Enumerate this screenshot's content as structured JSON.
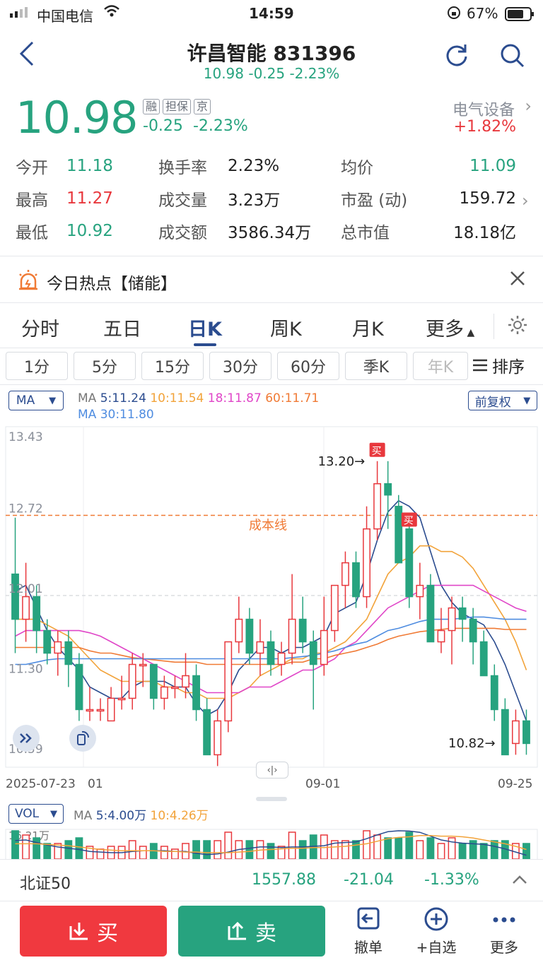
{
  "status_bar": {
    "carrier": "中国电信",
    "time": "14:59",
    "battery": "67%"
  },
  "header": {
    "title": "许昌智能 831396",
    "subtitle": "10.98 -0.25 -2.23%",
    "back_icon": "chevron-left-icon",
    "refresh_icon": "refresh-icon",
    "search_icon": "search-icon"
  },
  "quote": {
    "price": "10.98",
    "tags": [
      "融",
      "担保",
      "京"
    ],
    "change": "-0.25",
    "change_pct": "-2.23%",
    "sector": "电气设备",
    "sector_change": "+1.82%",
    "rows": [
      {
        "l1": "今开",
        "v1": "11.18",
        "l2": "换手率",
        "v2": "2.23%",
        "l3": "均价",
        "v3": "11.09"
      },
      {
        "l1": "最高",
        "v1": "11.27",
        "l2": "成交量",
        "v2": "3.23万",
        "l3": "市盈 (动)",
        "v3": "159.72"
      },
      {
        "l1": "最低",
        "v1": "10.92",
        "l2": "成交额",
        "v2": "3586.34万",
        "l3": "总市值",
        "v3": "18.18亿"
      }
    ]
  },
  "hot": {
    "text": "今日热点【储能】"
  },
  "tabs": [
    "分时",
    "五日",
    "日K",
    "周K",
    "月K",
    "更多"
  ],
  "active_tab": "日K",
  "periods": [
    "1分",
    "5分",
    "15分",
    "30分",
    "60分",
    "季K",
    "年K"
  ],
  "sort_label": "排序",
  "ma": {
    "selector": "MA",
    "line1_prefix": "MA",
    "ma5": "5:11.24",
    "ma10": "10:11.54",
    "ma18": "18:11.87",
    "ma60": "60:11.71",
    "line2": "MA 30:11.80",
    "adjust": "前复权"
  },
  "chart_labels": {
    "y_ticks": [
      "13.43",
      "12.72",
      "12.01",
      "11.30",
      "10.59"
    ],
    "x_ticks": [
      "2025-07-23",
      "01",
      "09-01",
      "09-25"
    ],
    "cost_line": "成本线",
    "high_note": "13.20→",
    "low_note": "10.82→",
    "buy_marker": "买"
  },
  "chart_data": {
    "type": "candlestick",
    "ylim": [
      10.59,
      13.43
    ],
    "cost_line": 12.72,
    "candles": [
      [
        12.2,
        11.8,
        12.7,
        11.5
      ],
      [
        11.8,
        12.0,
        12.3,
        11.6
      ],
      [
        12.0,
        11.7,
        12.1,
        11.5
      ],
      [
        11.7,
        11.5,
        11.8,
        11.4
      ],
      [
        11.5,
        11.6,
        11.7,
        11.3
      ],
      [
        11.6,
        11.4,
        11.7,
        11.2
      ],
      [
        11.4,
        11.0,
        11.5,
        10.9
      ],
      [
        11.0,
        11.0,
        11.2,
        10.9
      ],
      [
        11.0,
        11.0,
        11.1,
        10.9
      ],
      [
        10.9,
        11.1,
        11.2,
        10.9
      ],
      [
        11.1,
        11.1,
        11.3,
        11.0
      ],
      [
        11.1,
        11.4,
        11.5,
        11.0
      ],
      [
        11.4,
        11.4,
        11.5,
        11.2
      ],
      [
        11.4,
        11.1,
        11.4,
        11.0
      ],
      [
        11.1,
        11.2,
        11.3,
        11.0
      ],
      [
        11.2,
        11.2,
        11.3,
        11.1
      ],
      [
        11.2,
        11.3,
        11.5,
        11.1
      ],
      [
        11.3,
        11.0,
        11.4,
        10.9
      ],
      [
        11.0,
        10.6,
        11.1,
        10.6
      ],
      [
        10.6,
        10.9,
        11.0,
        10.5
      ],
      [
        10.9,
        11.6,
        11.6,
        10.8
      ],
      [
        11.6,
        11.8,
        12.0,
        11.5
      ],
      [
        11.8,
        11.5,
        11.9,
        11.4
      ],
      [
        11.5,
        11.6,
        11.8,
        11.3
      ],
      [
        11.6,
        11.4,
        11.7,
        11.3
      ],
      [
        11.4,
        11.5,
        11.6,
        11.3
      ],
      [
        11.5,
        11.8,
        12.2,
        11.4
      ],
      [
        11.8,
        11.6,
        12.0,
        11.5
      ],
      [
        11.6,
        11.4,
        11.7,
        11.0
      ],
      [
        11.4,
        11.7,
        12.0,
        11.3
      ],
      [
        11.7,
        12.1,
        12.1,
        11.6
      ],
      [
        12.1,
        12.3,
        12.4,
        11.9
      ],
      [
        12.3,
        12.0,
        12.4,
        11.9
      ],
      [
        12.0,
        12.6,
        12.8,
        11.9
      ],
      [
        12.6,
        13.0,
        13.2,
        12.5
      ],
      [
        13.0,
        12.9,
        13.2,
        12.6
      ],
      [
        12.8,
        12.3,
        12.9,
        12.3
      ],
      [
        12.6,
        12.0,
        12.7,
        11.9
      ],
      [
        12.0,
        12.1,
        12.3,
        11.8
      ],
      [
        12.1,
        11.6,
        12.2,
        11.6
      ],
      [
        11.6,
        11.7,
        11.9,
        11.5
      ],
      [
        11.7,
        11.9,
        12.0,
        11.4
      ],
      [
        11.9,
        11.8,
        12.0,
        11.6
      ],
      [
        11.8,
        11.6,
        11.9,
        11.4
      ],
      [
        11.6,
        11.3,
        11.7,
        11.3
      ],
      [
        11.3,
        11.0,
        11.4,
        10.9
      ],
      [
        11.0,
        10.6,
        11.1,
        10.6
      ],
      [
        10.7,
        10.9,
        11.0,
        10.6
      ],
      [
        10.9,
        10.7,
        11.0,
        10.6
      ]
    ],
    "series": [
      {
        "name": "MA5",
        "color": "#2b4c8f",
        "values": [
          12.05,
          12.1,
          11.9,
          11.7,
          11.55,
          11.45,
          11.35,
          11.2,
          11.15,
          11.1,
          11.1,
          11.2,
          11.25,
          11.25,
          11.25,
          11.2,
          11.2,
          11.05,
          10.95,
          11.0,
          11.15,
          11.35,
          11.45,
          11.55,
          11.55,
          11.5,
          11.55,
          11.55,
          11.6,
          11.65,
          11.85,
          11.9,
          11.95,
          12.2,
          12.5,
          12.75,
          12.85,
          12.8,
          12.7,
          12.4,
          12.1,
          11.95,
          11.85,
          11.8,
          11.75,
          11.6,
          11.4,
          11.15,
          10.9
        ]
      },
      {
        "name": "MA10",
        "color": "#f2a33a",
        "values": [
          11.8,
          11.8,
          11.8,
          11.75,
          11.7,
          11.65,
          11.55,
          11.45,
          11.35,
          11.3,
          11.25,
          11.25,
          11.25,
          11.25,
          11.2,
          11.2,
          11.15,
          11.15,
          11.1,
          11.1,
          11.1,
          11.15,
          11.2,
          11.3,
          11.35,
          11.4,
          11.45,
          11.45,
          11.5,
          11.5,
          11.55,
          11.6,
          11.7,
          11.8,
          12.0,
          12.2,
          12.3,
          12.35,
          12.45,
          12.45,
          12.4,
          12.4,
          12.35,
          12.25,
          12.1,
          11.95,
          11.8,
          11.6,
          11.35
        ]
      },
      {
        "name": "MA18",
        "color": "#e046c8",
        "values": [
          11.65,
          11.7,
          11.7,
          11.7,
          11.7,
          11.7,
          11.7,
          11.68,
          11.65,
          11.6,
          11.55,
          11.5,
          11.45,
          11.4,
          11.35,
          11.3,
          11.25,
          11.2,
          11.15,
          11.15,
          11.15,
          11.15,
          11.2,
          11.2,
          11.2,
          11.25,
          11.3,
          11.35,
          11.35,
          11.4,
          11.45,
          11.55,
          11.6,
          11.7,
          11.8,
          11.9,
          11.95,
          12.0,
          12.05,
          12.1,
          12.1,
          12.1,
          12.1,
          12.1,
          12.05,
          12.0,
          11.95,
          11.9,
          11.87
        ]
      },
      {
        "name": "MA60",
        "color": "#f07a35",
        "values": [
          11.55,
          11.55,
          11.55,
          11.55,
          11.55,
          11.55,
          11.55,
          11.52,
          11.5,
          11.5,
          11.48,
          11.46,
          11.45,
          11.44,
          11.43,
          11.42,
          11.42,
          11.42,
          11.4,
          11.4,
          11.4,
          11.4,
          11.4,
          11.4,
          11.4,
          11.4,
          11.42,
          11.42,
          11.45,
          11.45,
          11.48,
          11.5,
          11.52,
          11.55,
          11.58,
          11.62,
          11.65,
          11.67,
          11.69,
          11.7,
          11.71,
          11.72,
          11.72,
          11.72,
          11.72,
          11.72,
          11.71,
          11.71,
          11.71
        ]
      },
      {
        "name": "MA30",
        "color": "#4e8ce0",
        "values": [
          11.4,
          11.4,
          11.42,
          11.44,
          11.45,
          11.45,
          11.45,
          11.45,
          11.45,
          11.45,
          11.45,
          11.45,
          11.45,
          11.45,
          11.45,
          11.45,
          11.45,
          11.45,
          11.45,
          11.45,
          11.45,
          11.45,
          11.45,
          11.45,
          11.45,
          11.45,
          11.46,
          11.47,
          11.48,
          11.5,
          11.52,
          11.55,
          11.58,
          11.6,
          11.65,
          11.7,
          11.72,
          11.75,
          11.78,
          11.8,
          11.8,
          11.8,
          11.81,
          11.82,
          11.82,
          11.81,
          11.8,
          11.8,
          11.8
        ]
      }
    ]
  },
  "vol": {
    "selector": "VOL",
    "prefix": "MA",
    "ma5": "5:4.00万",
    "ma10": "10:4.26万",
    "max": "16.21万"
  },
  "index_bar": {
    "name": "北证50",
    "value": "1557.88",
    "change": "-21.04",
    "change_pct": "-1.33%"
  },
  "bottom": {
    "buy": "买",
    "sell": "卖",
    "cancel": "撤单",
    "add": "+自选",
    "more": "更多"
  }
}
